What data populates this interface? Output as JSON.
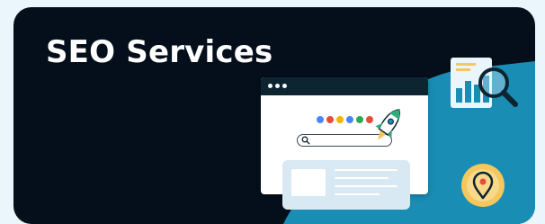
{
  "banner": {
    "title": "SEO Services"
  },
  "colors": {
    "background": "#eaf5fc",
    "card": "#040f1b",
    "accent_blue": "#1a8db5",
    "browser_bar": "#0d2431",
    "yellow": "#f5c75c",
    "google_dots": [
      "#4a86f7",
      "#e94b3c",
      "#f4b400",
      "#4a86f7",
      "#2fa84f",
      "#e94b3c"
    ]
  },
  "icons": {
    "search": "magnifier-icon",
    "rocket": "rocket-icon",
    "analytics": "bar-chart-icon",
    "location": "location-pin-icon"
  }
}
